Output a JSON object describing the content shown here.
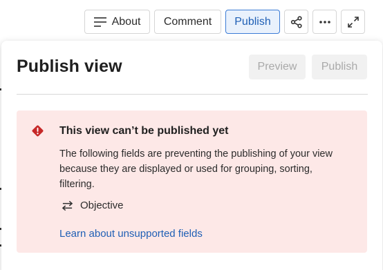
{
  "toolbar": {
    "about_label": "About",
    "comment_label": "Comment",
    "publish_label": "Publish",
    "share_icon": "share-icon",
    "more_icon": "more-horizontal-icon",
    "expand_icon": "expand-icon"
  },
  "panel": {
    "title": "Publish view",
    "preview_label": "Preview",
    "publish_label": "Publish"
  },
  "alert": {
    "title": "This view can’t be published yet",
    "body": "The following fields are preventing the publishing of your view because they are displayed or used for grouping, sorting, filtering.",
    "fields": [
      {
        "name": "Objective",
        "icon": "swap-arrows-icon"
      }
    ],
    "link_text": "Learn about unsupported fields",
    "icon": "warning-diamond-icon"
  },
  "colors": {
    "accent": "#1f5fb5",
    "publish_active_bg": "#e9f1fc",
    "alert_bg": "#fde8e7",
    "alert_icon": "#c62828",
    "disabled_text": "#a9a9a9"
  }
}
